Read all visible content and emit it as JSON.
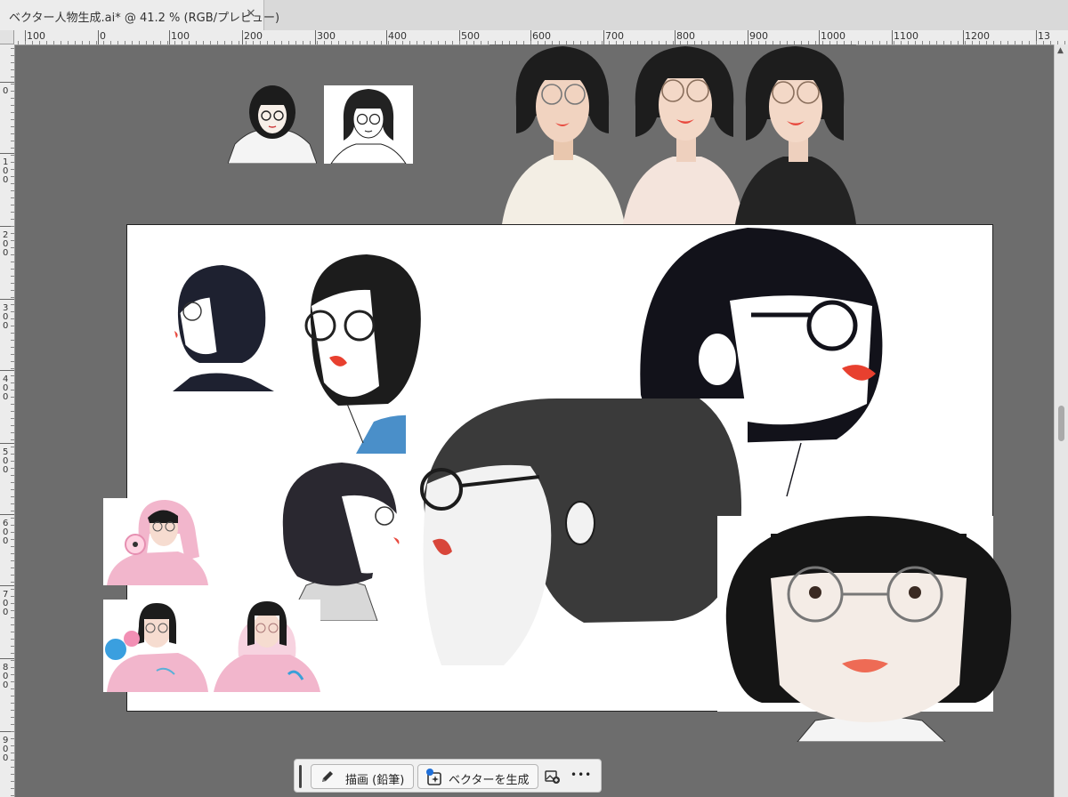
{
  "document_tab": {
    "title": "ベクター人物生成.ai* @ 41.2 % (RGB/プレビュー)",
    "close_glyph": "×"
  },
  "rulers": {
    "horizontal_labels": [
      "100",
      "0",
      "100",
      "200",
      "300",
      "400",
      "500",
      "600",
      "700",
      "800",
      "900",
      "1000",
      "1100",
      "1200",
      "13"
    ],
    "vertical_labels": [
      "0",
      "100",
      "200",
      "300",
      "400",
      "500",
      "600",
      "700",
      "800",
      "900"
    ]
  },
  "canvas": {
    "zoom_percent": 41.2,
    "color_mode": "RGB",
    "view_mode": "プレビュー",
    "artboard_color": "#ffffff",
    "pasteboard_color": "#6d6d6d"
  },
  "artwork": [
    {
      "name": "portrait-hoodie-sketch",
      "icon": "portrait-thumbnail"
    },
    {
      "name": "portrait-lineart-sketch",
      "icon": "portrait-thumbnail"
    },
    {
      "name": "portrait-trio-glasses",
      "icon": "portrait-thumbnail"
    },
    {
      "name": "portrait-profile-small",
      "icon": "portrait-thumbnail"
    },
    {
      "name": "portrait-glasses-blue-top",
      "icon": "portrait-thumbnail"
    },
    {
      "name": "portrait-large-glasses",
      "icon": "portrait-thumbnail"
    },
    {
      "name": "portrait-profile-grey",
      "icon": "portrait-thumbnail"
    },
    {
      "name": "portrait-closeup-ink",
      "icon": "portrait-thumbnail"
    },
    {
      "name": "portrait-front-glasses",
      "icon": "portrait-thumbnail"
    },
    {
      "name": "portrait-pink-hoodie-flower",
      "icon": "portrait-thumbnail"
    },
    {
      "name": "portrait-pink-hoodie-blue-flower",
      "icon": "portrait-thumbnail"
    },
    {
      "name": "portrait-pink-hoodie-front",
      "icon": "portrait-thumbnail"
    }
  ],
  "taskbar": {
    "draw_button_label": "描画 (鉛筆)",
    "draw_button_icon": "pencil-icon",
    "generate_vector_label": "ベクターを生成",
    "generate_vector_icon": "sparkle-icon",
    "add_image_icon": "add-image-icon",
    "more_label": "•••"
  },
  "colors": {
    "accent_blue": "#1e6fd9",
    "ink": "#1a1a1a",
    "lip_red": "#e84a3f",
    "pink_hoodie": "#f2b6cc",
    "blue_top": "#4a8fc9"
  }
}
